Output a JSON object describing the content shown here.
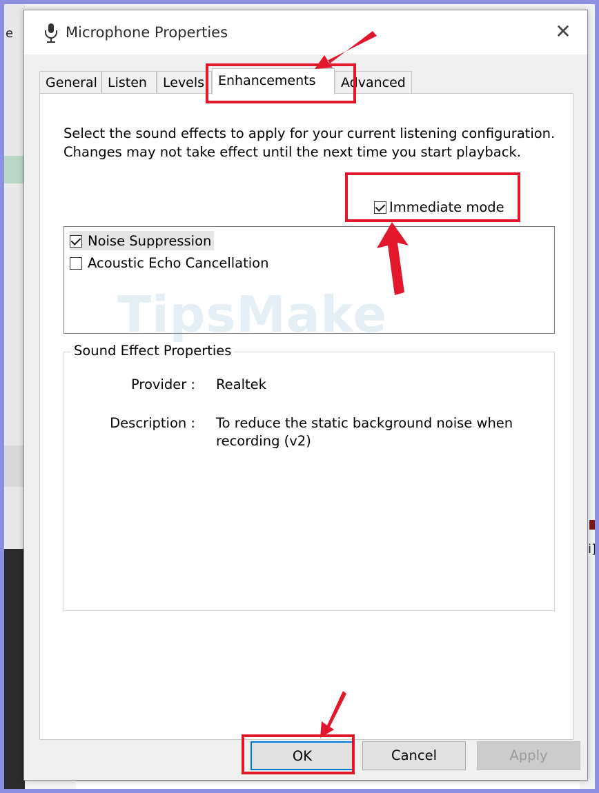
{
  "dialog": {
    "title": "Microphone Properties",
    "close_glyph": "✕",
    "tabs": [
      {
        "label": "General",
        "active": false
      },
      {
        "label": "Listen",
        "active": false
      },
      {
        "label": "Levels",
        "active": false
      },
      {
        "label": "Enhancements",
        "active": true
      },
      {
        "label": "Advanced",
        "active": false
      }
    ],
    "description": "Select the sound effects to apply for your current listening configuration. Changes may not take effect until the next time you start playback.",
    "immediate_mode": {
      "label": "Immediate mode",
      "checked": true
    },
    "effects": [
      {
        "label": "Noise Suppression",
        "checked": true,
        "selected": true
      },
      {
        "label": "Acoustic Echo Cancellation",
        "checked": false,
        "selected": false
      }
    ],
    "sound_effect_properties": {
      "title": "Sound Effect Properties",
      "provider_label": "Provider :",
      "provider_value": "Realtek",
      "description_label": "Description :",
      "description_value": "To reduce the static background noise when recording (v2)"
    },
    "buttons": {
      "ok": "OK",
      "cancel": "Cancel",
      "apply": "Apply"
    }
  },
  "watermark": "TipsMake",
  "background": {
    "left_edge_letter": "e",
    "right_edge_letter": "i]"
  },
  "annotation_color": "#e3172b"
}
